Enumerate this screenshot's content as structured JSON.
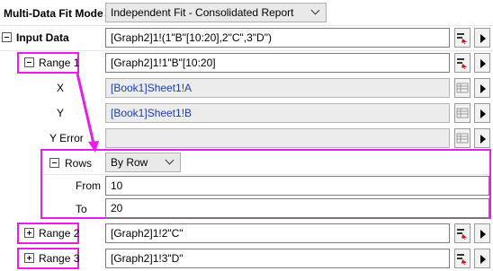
{
  "multi_data_fit_mode": {
    "label": "Multi-Data Fit Mode",
    "value": "Independent Fit - Consolidated Report"
  },
  "input_data": {
    "label": "Input Data",
    "value": "[Graph2]1!(1\"B\"[10:20],2\"C\",3\"D\")"
  },
  "range1": {
    "label": "Range 1",
    "value": "[Graph2]1!1\"B\"[10:20]",
    "x": {
      "label": "X",
      "value": "[Book1]Sheet1!A"
    },
    "y": {
      "label": "Y",
      "value": "[Book1]Sheet1!B"
    },
    "y_error": {
      "label": "Y Error",
      "value": ""
    },
    "rows": {
      "label": "Rows",
      "value": "By Row"
    },
    "from": {
      "label": "From",
      "value": "10"
    },
    "to": {
      "label": "To",
      "value": "20"
    }
  },
  "range2": {
    "label": "Range 2",
    "value": "[Graph2]1!2\"C\""
  },
  "range3": {
    "label": "Range 3",
    "value": "[Graph2]1!3\"D\""
  },
  "colors": {
    "highlight": "#e61ee6",
    "link_text": "#1a3fb0",
    "readonly_bg": "#ececec"
  }
}
